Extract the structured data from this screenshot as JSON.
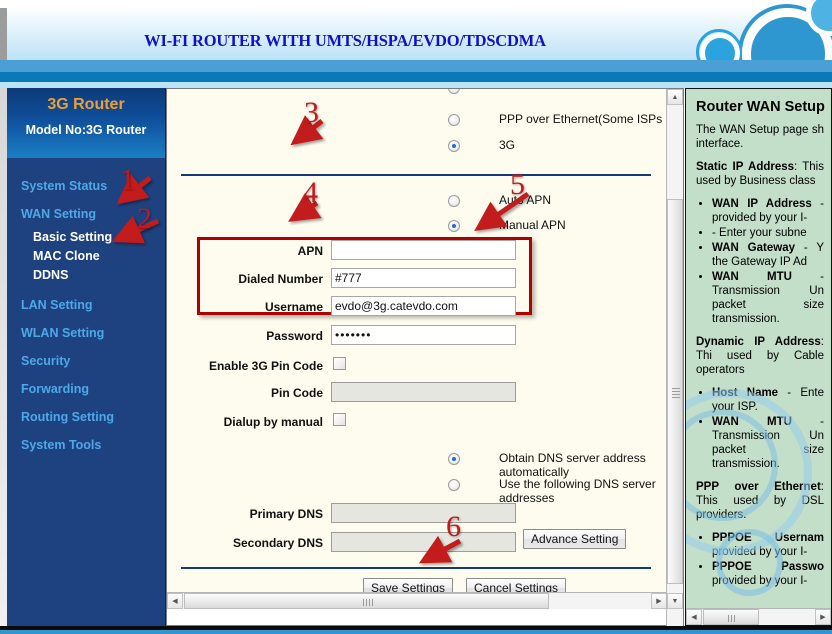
{
  "banner": {
    "title": "WI-FI ROUTER WITH UMTS/HSPA/EVDO/TDSCDMA"
  },
  "sidebar": {
    "brand": "3G Router",
    "model": "Model No:3G Router",
    "items": [
      {
        "label": "System Status",
        "type": "top"
      },
      {
        "label": "WAN Setting",
        "type": "top"
      },
      {
        "label": "Basic Setting",
        "type": "sub"
      },
      {
        "label": "MAC Clone",
        "type": "sub"
      },
      {
        "label": "DDNS",
        "type": "sub"
      },
      {
        "label": "LAN Setting",
        "type": "top"
      },
      {
        "label": "WLAN Setting",
        "type": "top"
      },
      {
        "label": "Security",
        "type": "top"
      },
      {
        "label": "Forwarding",
        "type": "top"
      },
      {
        "label": "Routing Setting",
        "type": "top"
      },
      {
        "label": "System Tools",
        "type": "top"
      }
    ]
  },
  "main": {
    "wan_type_options": [
      {
        "label": "PPP over Ethernet(Some ISPs require the use of PPPoE to co",
        "selected": false
      },
      {
        "label": "3G",
        "selected": true
      }
    ],
    "apn_mode": [
      {
        "label": "Auto APN",
        "selected": false
      },
      {
        "label": "Manual APN",
        "selected": true
      }
    ],
    "fields": [
      {
        "label": "APN",
        "value": "",
        "disabled": false
      },
      {
        "label": "Dialed Number",
        "value": "#777",
        "disabled": false
      },
      {
        "label": "Username",
        "value": "evdo@3g.catevdo.com",
        "disabled": false
      },
      {
        "label": "Password",
        "value": "•••••••",
        "disabled": false
      }
    ],
    "enable_pin_label": "Enable 3G Pin Code",
    "enable_pin_checked": false,
    "pin_code_label": "Pin Code",
    "pin_code_value": "",
    "dialup_manual_label": "Dialup by manual",
    "dialup_manual_checked": false,
    "dns_options": [
      {
        "label": "Obtain DNS server address automatically",
        "selected": true
      },
      {
        "label": "Use the following DNS server addresses",
        "selected": false
      }
    ],
    "dns_fields": [
      {
        "label": "Primary DNS",
        "value": "",
        "disabled": true
      },
      {
        "label": "Secondary DNS",
        "value": "",
        "disabled": true
      }
    ],
    "advance_button": "Advance Setting",
    "save_button": "Save Settings",
    "cancel_button": "Cancel Settings"
  },
  "help": {
    "title": "Router WAN Setup",
    "intro": "The WAN Setup page sh interface.",
    "static_heading": "Static IP Address",
    "static_text": ": This used by Business class",
    "static_bullets": [
      {
        "bold": "WAN IP Address",
        "rest": " - provided by your I-"
      },
      {
        "bold": "",
        "rest": " - Enter your subne"
      },
      {
        "bold": "WAN Gateway",
        "rest": " - Y the Gateway IP Ad"
      },
      {
        "bold": "WAN MTU",
        "rest": " - Transmission Un packet size transmission."
      }
    ],
    "dynamic_heading": "Dynamic IP Address",
    "dynamic_text": ": Thi used by Cable operators",
    "dynamic_bullets": [
      {
        "bold": "Host Name",
        "rest": " - Ente your ISP."
      },
      {
        "bold": "WAN MTU",
        "rest": " - Transmission Un packet size transmission."
      }
    ],
    "ppp_heading": "PPP over Ethernet",
    "ppp_text": ": This used by DSL providers.",
    "ppp_bullets": [
      {
        "bold": "PPPOE Usernam",
        "rest": " provided by your I-"
      },
      {
        "bold": "PPPOE Passwo",
        "rest": " provided by your I-"
      }
    ]
  },
  "annotations": {
    "markers": [
      "1",
      "2",
      "3",
      "4",
      "5",
      "6"
    ]
  },
  "colors": {
    "accent_blue": "#1e4280",
    "brand_orange": "#f0a030",
    "annotation_red": "#c21a1a",
    "help_bg": "#c3dec9",
    "form_bg": "#fdfcee"
  }
}
